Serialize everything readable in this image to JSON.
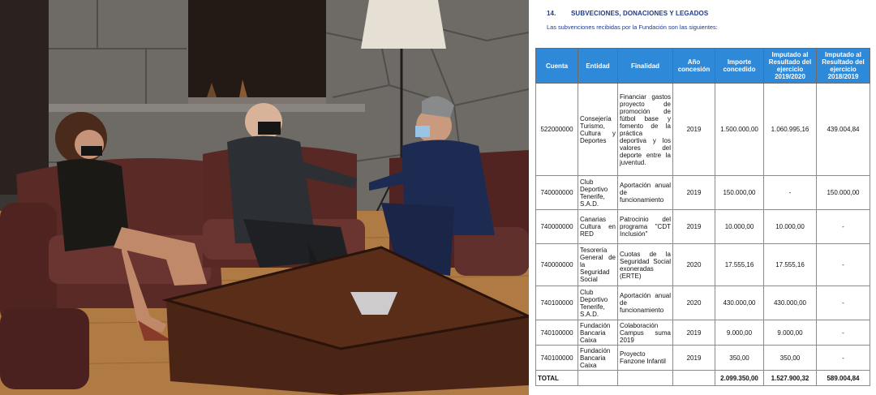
{
  "photo": {
    "description_icon": "meeting-photo"
  },
  "document": {
    "section_number": "14.",
    "section_title": "SUBVECIONES, DONACIONES Y LEGADOS",
    "intro": "Las subvenciones recibidas por la Fundación son las siguientes:",
    "columns": [
      "Cuenta",
      "Entidad",
      "Finalidad",
      "Año concesión",
      "Importe concedido",
      "Imputado al Resultado del ejercicio 2019/2020",
      "Imputado al Resultado del ejercicio 2018/2019"
    ],
    "rows": [
      {
        "cuenta": "522000000",
        "entidad": "Consejería Turismo, Cultura y Deportes",
        "finalidad": "Financiar gastos proyecto de promoción de fútbol base y fomento de la práctica deportiva y los valores del deporte entre la juventud.",
        "ano": "2019",
        "importe": "1.500.000,00",
        "imp2020": "1.060.995,16",
        "imp2019": "439.004,84"
      },
      {
        "cuenta": "740000000",
        "entidad": "Club Deportivo Tenerife, S.A.D.",
        "finalidad": "Aportación anual de funcionamiento",
        "ano": "2019",
        "importe": "150.000,00",
        "imp2020": "-",
        "imp2019": "150.000,00"
      },
      {
        "cuenta": "740000000",
        "entidad": "Canarias Cultura en RED",
        "finalidad": "Patrocinio del programa \"CDT Inclusión\"",
        "ano": "2019",
        "importe": "10.000,00",
        "imp2020": "10.000,00",
        "imp2019": "-"
      },
      {
        "cuenta": "740000000",
        "entidad": "Tesorería General de la Seguridad Social",
        "finalidad": "Cuotas de la Seguridad Social exoneradas (ERTE)",
        "ano": "2020",
        "importe": "17.555,16",
        "imp2020": "17.555,16",
        "imp2019": "-"
      },
      {
        "cuenta": "740100000",
        "entidad": "Club Deportivo Tenerife, S.A.D.",
        "finalidad": "Aportación anual de funcionamiento",
        "ano": "2020",
        "importe": "430.000,00",
        "imp2020": "430.000,00",
        "imp2019": "-"
      },
      {
        "cuenta": "740100000",
        "entidad": "Fundación Bancaria Caixa",
        "finalidad": "Colaboración Campus suma 2019",
        "ano": "2019",
        "importe": "9.000,00",
        "imp2020": "9.000,00",
        "imp2019": "-"
      },
      {
        "cuenta": "740100000",
        "entidad": "Fundación Bancaria Caixa",
        "finalidad": "Proyecto Fanzone Infantil",
        "ano": "2019",
        "importe": "350,00",
        "imp2020": "350,00",
        "imp2019": "-"
      }
    ],
    "total": {
      "label": "TOTAL",
      "importe": "2.099.350,00",
      "imp2020": "1.527.900,32",
      "imp2019": "589.004,84"
    }
  }
}
